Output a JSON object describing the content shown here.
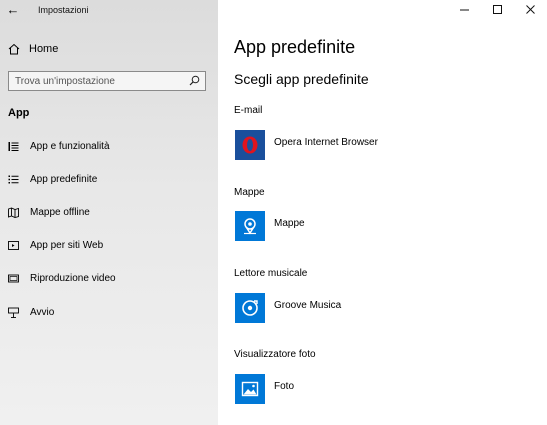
{
  "window": {
    "title": "Impostazioni"
  },
  "sidebar": {
    "home_label": "Home",
    "search_placeholder": "Trova un'impostazione",
    "section_title": "App",
    "items": [
      {
        "label": "App e funzionalità",
        "icon": "list-icon"
      },
      {
        "label": "App predefinite",
        "icon": "default-apps-icon"
      },
      {
        "label": "Mappe offline",
        "icon": "map-icon"
      },
      {
        "label": "App per siti Web",
        "icon": "web-app-icon"
      },
      {
        "label": "Riproduzione video",
        "icon": "video-icon"
      },
      {
        "label": "Avvio",
        "icon": "startup-icon"
      }
    ]
  },
  "main": {
    "title": "App predefinite",
    "subtitle": "Scegli app predefinite",
    "groups": [
      {
        "label": "E-mail",
        "app": "Opera Internet Browser",
        "icon": "opera-icon",
        "tile_color": "#1a4f9c"
      },
      {
        "label": "Mappe",
        "app": "Mappe",
        "icon": "maps-icon",
        "tile_color": "#0078d7"
      },
      {
        "label": "Lettore musicale",
        "app": "Groove Musica",
        "icon": "groove-icon",
        "tile_color": "#0078d7"
      },
      {
        "label": "Visualizzatore foto",
        "app": "Foto",
        "icon": "photos-icon",
        "tile_color": "#0078d7"
      }
    ]
  },
  "colors": {
    "accent": "#0078d7",
    "opera_red": "#e0141e"
  }
}
